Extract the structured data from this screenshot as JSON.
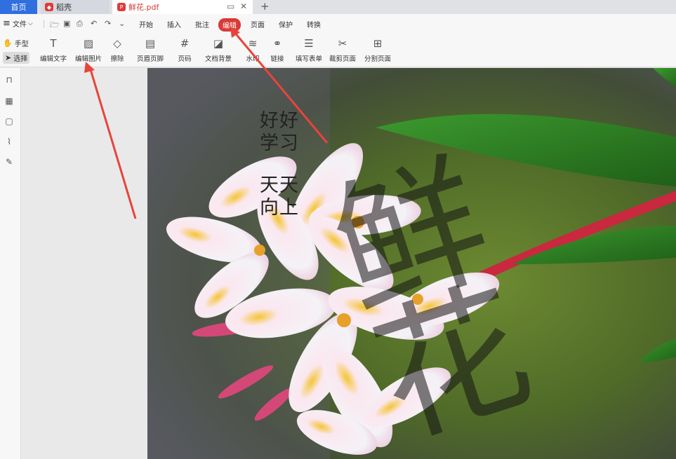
{
  "tabs": {
    "home": "首页",
    "daoke": "稻壳",
    "file": "鲜花.pdf"
  },
  "menu": {
    "file": "文件",
    "items": [
      "开始",
      "插入",
      "批注",
      "编辑",
      "页面",
      "保护",
      "转换"
    ],
    "active": "编辑"
  },
  "toolbar": {
    "hand": "手型",
    "select": "选择",
    "tools": [
      "编辑文字",
      "编辑图片",
      "擦除",
      "页眉页脚",
      "页码",
      "文档背景",
      "水印",
      "链接",
      "填写表单",
      "裁剪页面",
      "分割页面"
    ]
  },
  "page": {
    "text1": "好好学习",
    "text2": "天天向上",
    "watermark": "鲜花"
  },
  "colors": {
    "accent_red": "#d83b36",
    "tab_blue": "#2f6fe0",
    "arrow_red": "#e8443a"
  }
}
